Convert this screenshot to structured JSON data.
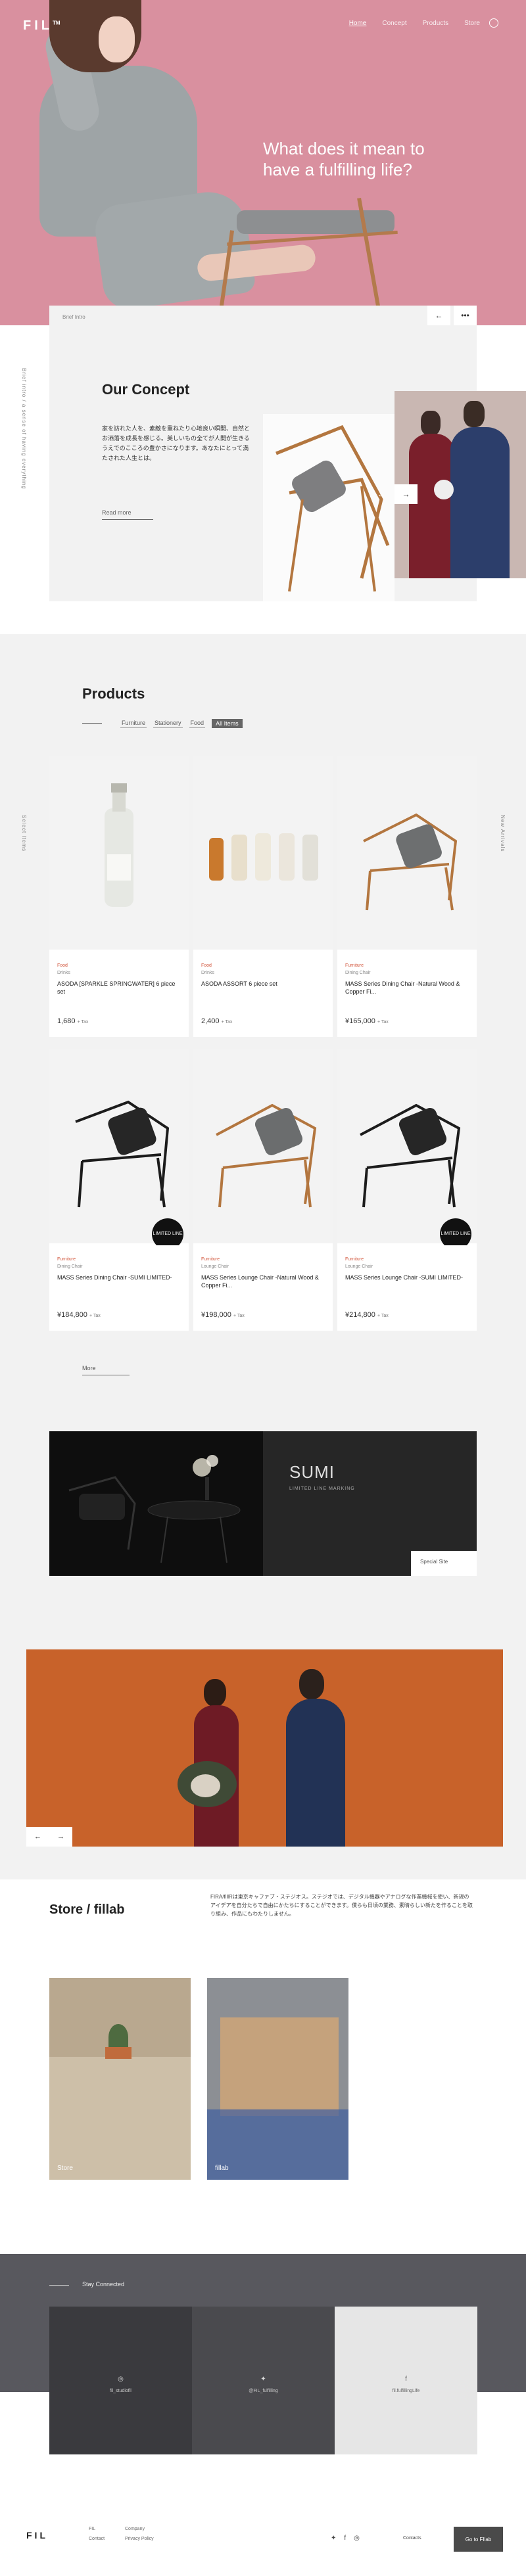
{
  "header": {
    "logo": "FIL",
    "logo_tm": "TM",
    "nav": [
      "Home",
      "Concept",
      "Products",
      "Store"
    ],
    "search_icon": "search-icon"
  },
  "hero": {
    "title": "What does it mean to have a fulfilling life?"
  },
  "concept": {
    "breadcrumb": "Brief Intro",
    "side_text": "Brief intro / a sense of having everything",
    "title": "Our Concept",
    "text": "家を訪れた人を、素敵を重ねたり心地良い瞬間、自然とお洒落を成長を感じる。美しいもの全てが人間が生きるうえでのこころの豊かさになります。あなたにとって満たされた人生とは。",
    "read_more": "Read more"
  },
  "products": {
    "side_left": "Select Items",
    "side_right": "New Arrivals",
    "title": "Products",
    "filters": [
      "Furniture",
      "Stationery",
      "Food",
      "All Items"
    ],
    "active_filter": "All Items",
    "items": [
      {
        "category": "Food",
        "sub": "Drinks",
        "name": "ASODA [SPARKLE SPRINGWATER] 6 piece set",
        "price": "1,680",
        "tax": "+ Tax"
      },
      {
        "category": "Food",
        "sub": "Drinks",
        "name": "ASODA ASSORT 6 piece set",
        "price": "2,400",
        "tax": "+ Tax"
      },
      {
        "category": "Furniture",
        "sub": "Dining Chair",
        "name": "MASS Series Dining Chair -Natural Wood & Copper Fi...",
        "price": "¥165,000",
        "tax": "+ Tax"
      },
      {
        "category": "Furniture",
        "sub": "Dining Chair",
        "name": "MASS Series Dining Chair -SUMI LIMITED-",
        "price": "¥184,800",
        "tax": "+ Tax",
        "badge": "LIMITED LINE"
      },
      {
        "category": "Furniture",
        "sub": "Lounge Chair",
        "name": "MASS Series Lounge Chair -Natural Wood & Copper Fi...",
        "price": "¥198,000",
        "tax": "+ Tax"
      },
      {
        "category": "Furniture",
        "sub": "Lounge Chair",
        "name": "MASS Series Lounge Chair -SUMI LIMITED-",
        "price": "¥214,800",
        "tax": "+ Tax",
        "badge": "LIMITED LINE"
      }
    ],
    "more": "More"
  },
  "sumi": {
    "title": "SUMI",
    "subtitle": "LIMITED LINE MARKING",
    "special": "Special Site"
  },
  "store": {
    "title": "Store / fillab",
    "text": "FIRA/fillRは東京キャファブ・ステジオス。ステジオでは、デジタル機器やアナログな作業機械を使い、新規のアイデアを自分たちで自由にかたちにすることができます。僕らも日頃の業務、素晴らしい新たを作ることを取り組み、作品にもわたりしません。",
    "images": [
      "Store",
      "fillab"
    ]
  },
  "stay": {
    "title": "Stay Connected",
    "tiles": [
      {
        "icon": "instagram-icon",
        "label": "fil_studiofil"
      },
      {
        "icon": "twitter-icon",
        "label": "@FIL_fulfilling"
      },
      {
        "icon": "facebook-icon",
        "label": "fil.fulfillingLife"
      }
    ]
  },
  "footer": {
    "logo": "FIL",
    "links": [
      "FIL",
      "Company",
      "Contact",
      "Privacy Policy"
    ],
    "contact_label": "Contacts",
    "button": "Go to FIlab"
  },
  "colors": {
    "hero_bg": "#d9909f",
    "accent": "#d2573d",
    "orange": "#c8622a",
    "dark": "#0e0e0e"
  }
}
